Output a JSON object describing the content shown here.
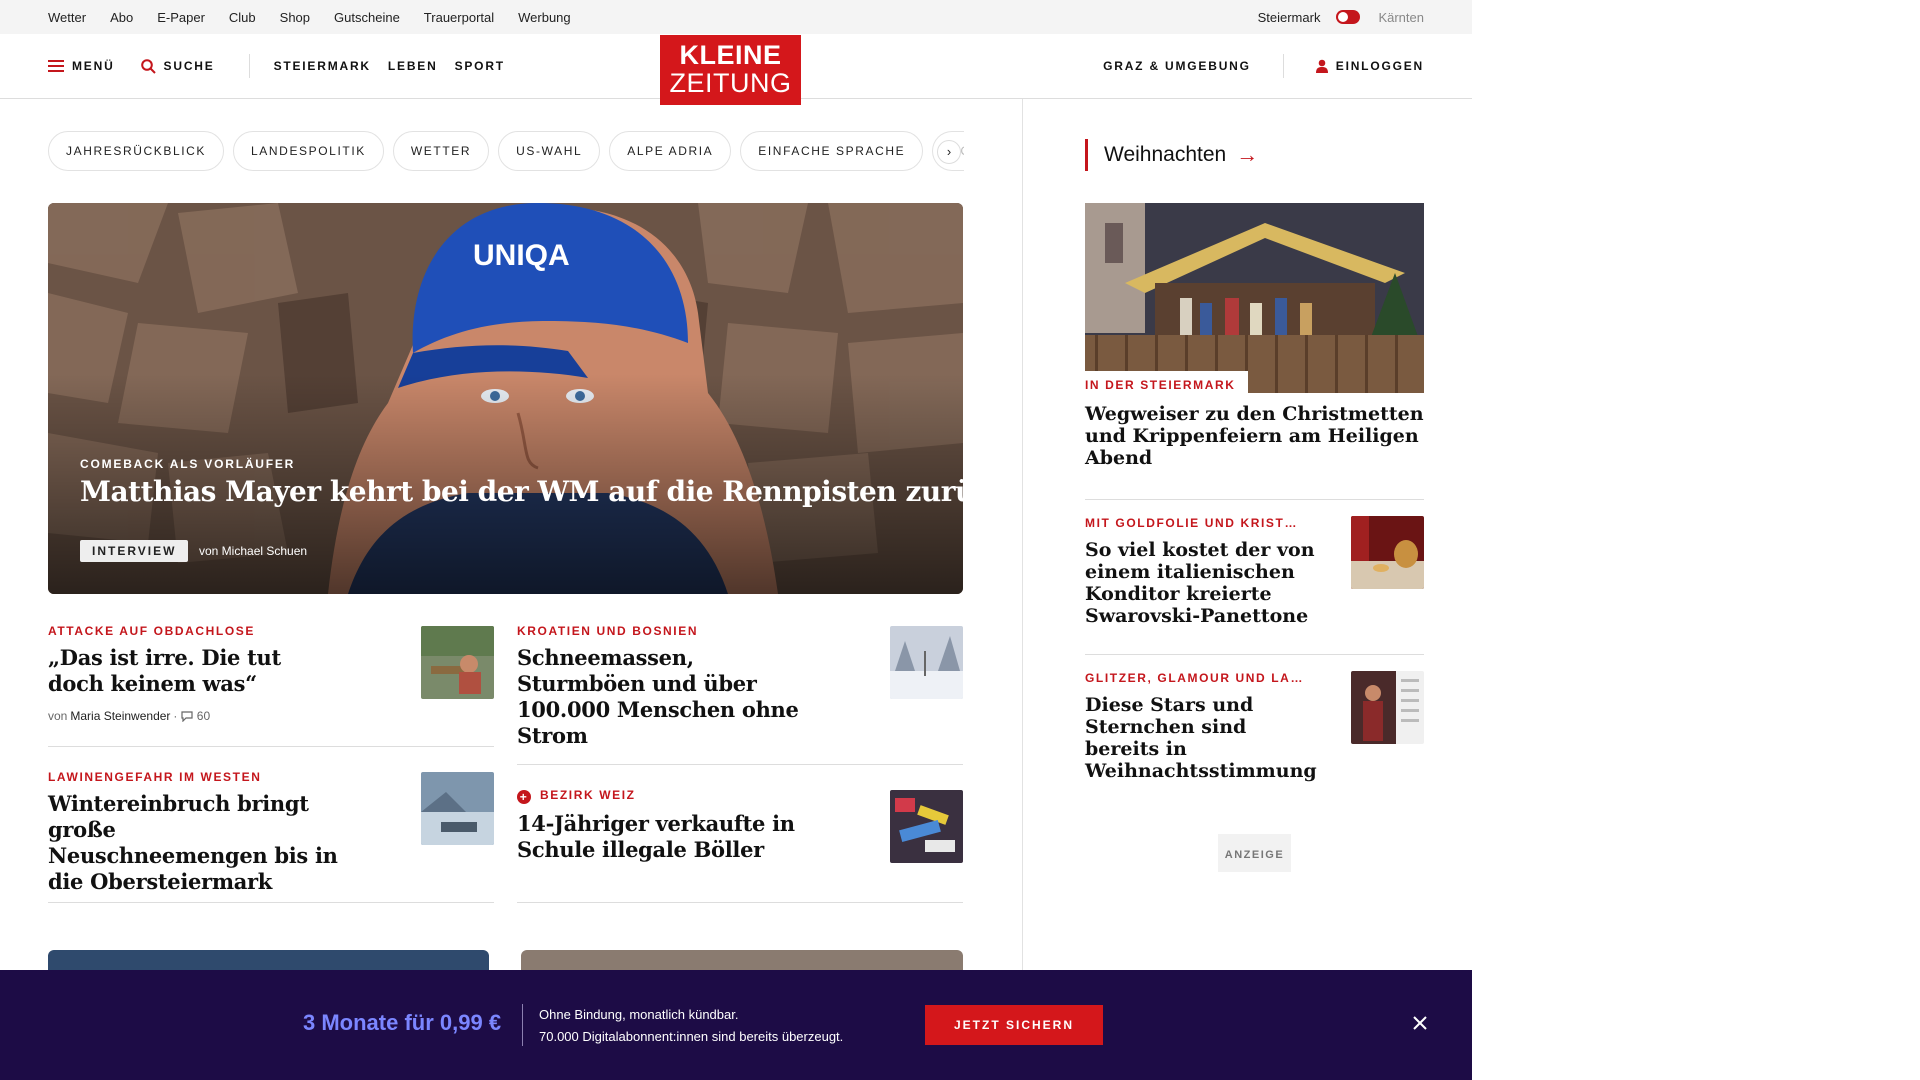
{
  "utility": {
    "links": [
      "Wetter",
      "Abo",
      "E-Paper",
      "Club",
      "Shop",
      "Gutscheine",
      "Trauerportal",
      "Werbung"
    ],
    "region_active": "Steiermark",
    "region_inactive": "Kärnten"
  },
  "header": {
    "menu_label": "MENÜ",
    "search_label": "SUCHE",
    "sections": [
      "STEIERMARK",
      "LEBEN",
      "SPORT"
    ],
    "logo_line1": "KLEINE",
    "logo_line2": "ZEITUNG",
    "region_label": "GRAZ & UMGEBUNG",
    "login_label": "EINLOGGEN"
  },
  "chips": [
    "JAHRESRÜCKBLICK",
    "LANDESPOLITIK",
    "WETTER",
    "US-WAHL",
    "ALPE ADRIA",
    "EINFACHE SPRACHE",
    "DO"
  ],
  "hero": {
    "kicker": "COMEBACK ALS VORLÄUFER",
    "title": "Matthias Mayer kehrt bei der WM auf die Rennpisten zurück",
    "badge": "INTERVIEW",
    "author": "von Michael Schuen",
    "cap_text": "UNIQA"
  },
  "cards": [
    {
      "kicker": "ATTACKE AUF OBDACHLOSE",
      "title": "„Das ist irre. Die tut doch keinem was“",
      "meta_prefix": "von",
      "meta_author": "Maria Steinwender",
      "meta_comments": "60"
    },
    {
      "kicker": "KROATIEN UND BOSNIEN",
      "title": "Schneemassen, Sturmböen und über 100.000 Menschen ohne Strom"
    },
    {
      "kicker": "LAWINENGEFAHR IM WESTEN",
      "title": "Wintereinbruch bringt große Neuschneemengen bis in die Obersteiermark"
    },
    {
      "kicker": "BEZIRK WEIZ",
      "title": "14-Jähriger verkaufte in Schule illegale Böller"
    }
  ],
  "sidebar": {
    "section_title": "Weihnachten",
    "lead_tag": "IN DER STEIERMARK",
    "lead_title": "Wegweiser zu den Christmetten und Krippenfeiern am Heiligen Abend",
    "items": [
      {
        "kicker": "MIT GOLDFOLIE UND KRIST…",
        "title": "So viel kostet der von einem italienischen Konditor kreierte Swarovski-Panettone"
      },
      {
        "kicker": "GLITZER, GLAMOUR UND LA…",
        "title": "Diese Stars und Sternchen sind bereits in Weihnachtsstimmung"
      }
    ],
    "ad_label": "ANZEIGE"
  },
  "offer": {
    "price": "3 Monate für 0,99 €",
    "line1": "Ohne Bindung, monatlich kündbar.",
    "line2": "70.000 Digitalabonnent:innen sind bereits überzeugt.",
    "cta": "JETZT SICHERN"
  },
  "colors": {
    "brand_red": "#d4171b",
    "offer_bg": "#1d0c46",
    "price_blue": "#7b86ff"
  }
}
